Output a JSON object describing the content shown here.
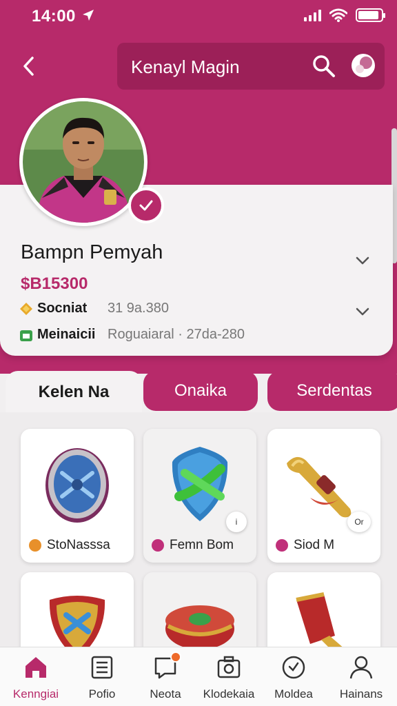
{
  "status": {
    "time": "14:00",
    "battery_level": 0.9
  },
  "header": {
    "search_text": "Kenayl Magin"
  },
  "profile": {
    "name": "Bampn Pemyah",
    "value": "$B15300",
    "rows": [
      {
        "label": "Socniat",
        "value": "31 9a.380"
      },
      {
        "label": "Meinaicii",
        "value": "Roguaiaral · 27da-280"
      }
    ]
  },
  "tabs": [
    "Kelen Na",
    "Onaika",
    "Serdentas"
  ],
  "items": [
    {
      "label": "StoNasssa",
      "dot_color": "#e8902a",
      "icon": "shield-icon"
    },
    {
      "label": "Femn Bom",
      "dot_color": "#c0307a",
      "icon": "emblem-icon"
    },
    {
      "label": "Siod M",
      "dot_color": "#c0307a",
      "icon": "horn-icon",
      "badge": "Or"
    },
    {
      "label": "",
      "icon": "crest-icon"
    },
    {
      "label": "",
      "icon": "drum-icon"
    },
    {
      "label": "",
      "icon": "goblet-icon"
    }
  ],
  "badge_mid": "i",
  "nav": [
    {
      "label": "Kenngiai",
      "icon": "home-icon"
    },
    {
      "label": "Pofio",
      "icon": "list-icon"
    },
    {
      "label": "Neota",
      "icon": "notes-icon"
    },
    {
      "label": "Klodekaia",
      "icon": "camera-icon"
    },
    {
      "label": "Moldea",
      "icon": "clock-icon"
    },
    {
      "label": "Hainans",
      "icon": "person-icon"
    }
  ],
  "colors": {
    "accent": "#b72a6a",
    "accent_dark": "#9c2058",
    "background": "#f1eff0"
  }
}
